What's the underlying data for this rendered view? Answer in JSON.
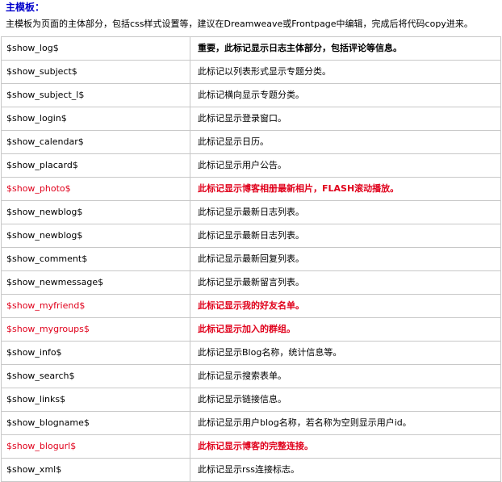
{
  "section": {
    "title": "主模板：",
    "intro": "主模板为页面的主体部分，包括css样式设置等，建议在Dreamweave或Frontpage中编辑，完成后将代码copy进来。"
  },
  "rows": [
    {
      "tag": "$show_log$",
      "desc": "重要，此标记显示日志主体部分，包括评论等信息。",
      "style": "bold"
    },
    {
      "tag": "$show_subject$",
      "desc": "此标记以列表形式显示专题分类。",
      "style": "normal"
    },
    {
      "tag": "$show_subject_l$",
      "desc": "此标记横向显示专题分类。",
      "style": "normal"
    },
    {
      "tag": "$show_login$",
      "desc": "此标记显示登录窗口。",
      "style": "normal"
    },
    {
      "tag": "$show_calendar$",
      "desc": "此标记显示日历。",
      "style": "normal"
    },
    {
      "tag": "$show_placard$",
      "desc": "此标记显示用户公告。",
      "style": "normal"
    },
    {
      "tag": "$show_photo$",
      "desc": "此标记显示博客相册最新相片，FLASH滚动播放。",
      "style": "red"
    },
    {
      "tag": "$show_newblog$",
      "desc": "此标记显示最新日志列表。",
      "style": "normal"
    },
    {
      "tag": "$show_newblog$",
      "desc": "此标记显示最新日志列表。",
      "style": "normal"
    },
    {
      "tag": "$show_comment$",
      "desc": "此标记显示最新回复列表。",
      "style": "normal"
    },
    {
      "tag": "$show_newmessage$",
      "desc": "此标记显示最新留言列表。",
      "style": "normal"
    },
    {
      "tag": "$show_myfriend$",
      "desc": "此标记显示我的好友名单。",
      "style": "red"
    },
    {
      "tag": "$show_mygroups$",
      "desc": "此标记显示加入的群组。",
      "style": "red"
    },
    {
      "tag": "$show_info$",
      "desc": "此标记显示Blog名称，统计信息等。",
      "style": "normal"
    },
    {
      "tag": "$show_search$",
      "desc": "此标记显示搜索表单。",
      "style": "normal"
    },
    {
      "tag": "$show_links$",
      "desc": "此标记显示链接信息。",
      "style": "normal"
    },
    {
      "tag": "$show_blogname$",
      "desc": "此标记显示用户blog名称，若名称为空则显示用户id。",
      "style": "normal"
    },
    {
      "tag": "$show_blogurl$",
      "desc": "此标记显示博客的完整连接。",
      "style": "red"
    },
    {
      "tag": "$show_xml$",
      "desc": "此标记显示rss连接标志。",
      "style": "normal"
    }
  ],
  "colors": {
    "heading": "#0000cc",
    "highlight": "#e0001b",
    "border": "#c8c8c8"
  }
}
